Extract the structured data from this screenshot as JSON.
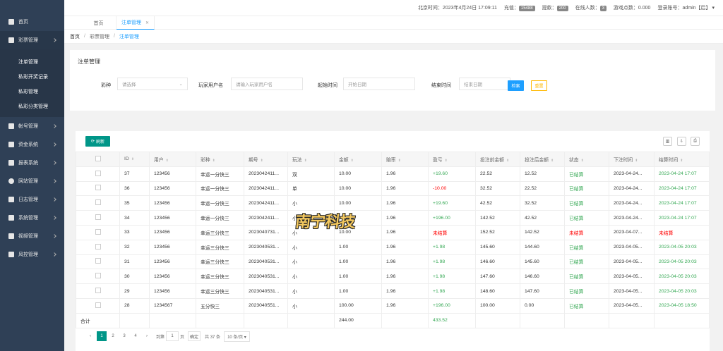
{
  "sidebar": {
    "items": [
      {
        "label": "首页",
        "icon": "home-icon"
      },
      {
        "label": "彩票管理",
        "icon": "gamepad-icon",
        "active": true
      },
      {
        "label": "帐号管理",
        "icon": "user-icon"
      },
      {
        "label": "资金系统",
        "icon": "bank-icon"
      },
      {
        "label": "报表系统",
        "icon": "bank-icon"
      },
      {
        "label": "网站管理",
        "icon": "gear-icon"
      },
      {
        "label": "日志管理",
        "icon": "bar-chart-icon"
      },
      {
        "label": "系统管理",
        "icon": "bar-chart-icon"
      },
      {
        "label": "视频管理",
        "icon": "video-icon"
      },
      {
        "label": "风控管理",
        "icon": "bar-chart-icon"
      }
    ],
    "sub_items": [
      "注单管理",
      "私彩开奖记录",
      "私彩管理",
      "私彩分类管理"
    ]
  },
  "topbar": {
    "time_label": "北京时间：2023年4月24日 17:09:11",
    "recharge_label": "充值：",
    "recharge_count": "15488",
    "withdraw_label": "提款：",
    "withdraw_count": "200",
    "online_label": "在线人数：",
    "online_count": "3",
    "game_points": "游戏点数：0.000",
    "account": "登录账号：admin【后】"
  },
  "tabs": {
    "home": "首页",
    "current": "注单管理",
    "close": "✕"
  },
  "breadcrumb": {
    "home": "首页",
    "sep": "/",
    "section": "彩票管理",
    "page": "注单管理"
  },
  "search": {
    "title": "注单管理",
    "lottery_label": "彩种",
    "lottery_placeholder": "请选择",
    "player_label": "玩家用户名",
    "player_placeholder": "请输入玩家用户名",
    "start_label": "起始时间",
    "start_placeholder": "开始日期",
    "end_label": "结束时间",
    "end_placeholder": "结束日期",
    "search_button": "检索",
    "reset_button": "重置"
  },
  "table": {
    "refresh_label": "刷新",
    "columns": [
      "ID",
      "用户",
      "彩种",
      "期号",
      "玩法",
      "金额",
      "赔率",
      "盈亏",
      "投注前金额",
      "投注后金额",
      "状态",
      "下注时间",
      "结算时间"
    ],
    "rows": [
      {
        "id": "37",
        "user": "123456",
        "lottery": "幸运一分快三",
        "issue": "2023042411...",
        "play": "双",
        "amount": "10.00",
        "odds": "1.96",
        "profit": "+19.60",
        "before": "22.52",
        "after": "12.52",
        "status": "已结算",
        "bet_time": "2023-04-24...",
        "settle_time": "2023-04-24 17:07"
      },
      {
        "id": "36",
        "user": "123456",
        "lottery": "幸运一分快三",
        "issue": "2023042411...",
        "play": "单",
        "amount": "10.00",
        "odds": "1.96",
        "profit": "-10.00",
        "before": "32.52",
        "after": "22.52",
        "status": "已结算",
        "bet_time": "2023-04-24...",
        "settle_time": "2023-04-24 17:07"
      },
      {
        "id": "35",
        "user": "123456",
        "lottery": "幸运一分快三",
        "issue": "2023042411...",
        "play": "小",
        "amount": "10.00",
        "odds": "1.96",
        "profit": "+19.60",
        "before": "42.52",
        "after": "32.52",
        "status": "已结算",
        "bet_time": "2023-04-24...",
        "settle_time": "2023-04-24 17:07"
      },
      {
        "id": "34",
        "user": "123456",
        "lottery": "幸运一分快三",
        "issue": "2023042411...",
        "play": "小",
        "amount": "100.00",
        "odds": "1.96",
        "profit": "+196.00",
        "before": "142.52",
        "after": "42.52",
        "status": "已结算",
        "bet_time": "2023-04-24...",
        "settle_time": "2023-04-24 17:07"
      },
      {
        "id": "33",
        "user": "123456",
        "lottery": "幸运三分快三",
        "issue": "2023040731...",
        "play": "小",
        "amount": "10.00",
        "odds": "1.96",
        "profit": "未结算",
        "before": "152.52",
        "after": "142.52",
        "status": "未结算",
        "bet_time": "2023-04-07...",
        "settle_time": "未结算"
      },
      {
        "id": "32",
        "user": "123456",
        "lottery": "幸运三分快三",
        "issue": "2023040531...",
        "play": "小",
        "amount": "1.00",
        "odds": "1.96",
        "profit": "+1.98",
        "before": "145.60",
        "after": "144.60",
        "status": "已结算",
        "bet_time": "2023-04-05...",
        "settle_time": "2023-04-05 20:03"
      },
      {
        "id": "31",
        "user": "123456",
        "lottery": "幸运三分快三",
        "issue": "2023040531...",
        "play": "小",
        "amount": "1.00",
        "odds": "1.96",
        "profit": "+1.98",
        "before": "146.60",
        "after": "145.60",
        "status": "已结算",
        "bet_time": "2023-04-05...",
        "settle_time": "2023-04-05 20:03"
      },
      {
        "id": "30",
        "user": "123456",
        "lottery": "幸运三分快三",
        "issue": "2023040531...",
        "play": "小",
        "amount": "1.00",
        "odds": "1.96",
        "profit": "+1.98",
        "before": "147.60",
        "after": "146.60",
        "status": "已结算",
        "bet_time": "2023-04-05...",
        "settle_time": "2023-04-05 20:03"
      },
      {
        "id": "29",
        "user": "123456",
        "lottery": "幸运三分快三",
        "issue": "2023040531...",
        "play": "小",
        "amount": "1.00",
        "odds": "1.96",
        "profit": "+1.98",
        "before": "148.60",
        "after": "147.60",
        "status": "已结算",
        "bet_time": "2023-04-05...",
        "settle_time": "2023-04-05 20:03"
      },
      {
        "id": "28",
        "user": "1234567",
        "lottery": "五分快三",
        "issue": "2023040551...",
        "play": "小",
        "amount": "100.00",
        "odds": "1.96",
        "profit": "+196.00",
        "before": "100.00",
        "after": "0.00",
        "status": "已结算",
        "bet_time": "2023-04-05...",
        "settle_time": "2023-04-05 18:50"
      }
    ],
    "total_label": "合计",
    "total_amount": "244.00",
    "total_profit": "433.52"
  },
  "pager": {
    "prev": "‹",
    "pages": [
      "1",
      "2",
      "3",
      "4"
    ],
    "next": "›",
    "goto_label": "到第",
    "goto_value": "1",
    "page_unit": "页",
    "confirm": "确定",
    "total": "共 37 条",
    "page_size": "10 条/页"
  },
  "watermark": "南宁科技",
  "colors": {
    "sidebar": "#2f4056",
    "primary": "#1e9fff",
    "teal": "#009688",
    "warn": "#ffb800",
    "win": "#34a853",
    "loss": "#ff0000"
  }
}
